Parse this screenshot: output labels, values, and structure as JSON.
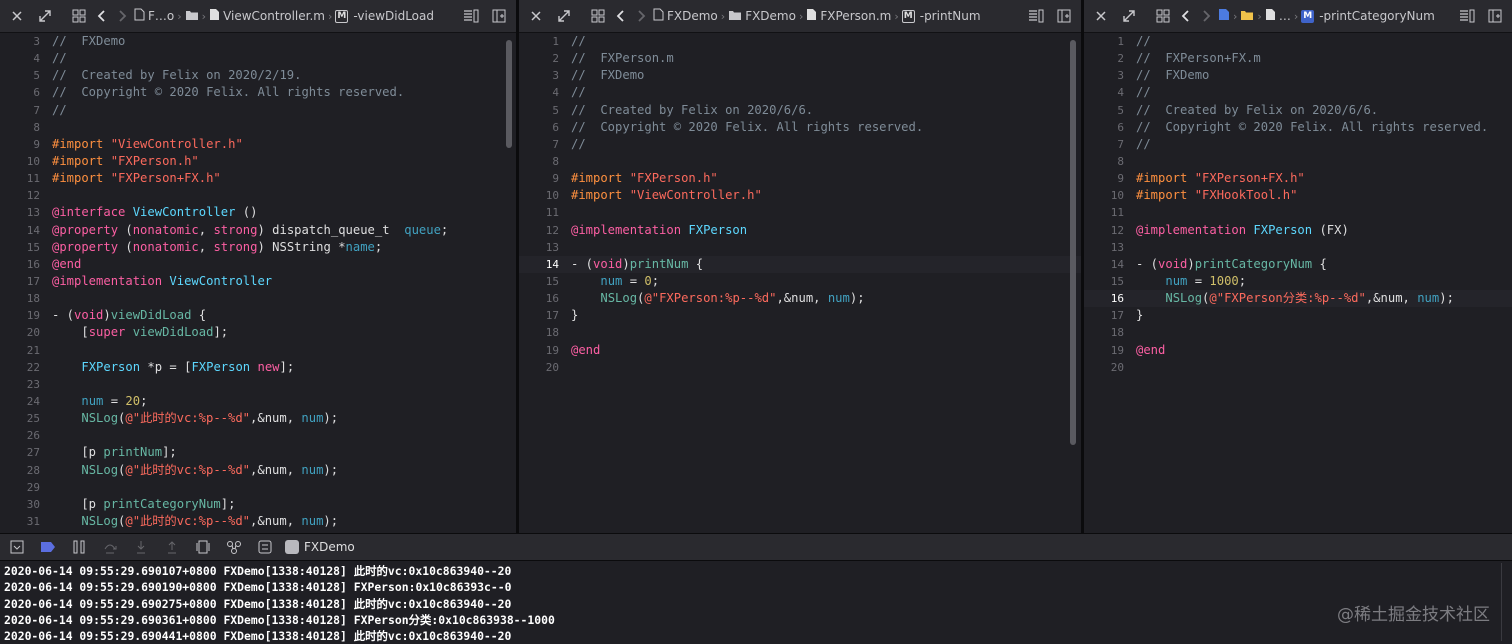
{
  "pane1": {
    "breadcrumbs": [
      "F…o",
      "",
      "ViewController.m",
      "-viewDidLoad"
    ],
    "lines": [
      {
        "n": "3",
        "t": [
          [
            "cmt",
            "//  FXDemo"
          ]
        ]
      },
      {
        "n": "4",
        "t": [
          [
            "cmt",
            "//"
          ]
        ]
      },
      {
        "n": "5",
        "t": [
          [
            "cmt",
            "//  Created by Felix on 2020/2/19."
          ]
        ]
      },
      {
        "n": "6",
        "t": [
          [
            "cmt",
            "//  Copyright © 2020 Felix. All rights reserved."
          ]
        ]
      },
      {
        "n": "7",
        "t": [
          [
            "cmt",
            "//"
          ]
        ]
      },
      {
        "n": "8",
        "t": []
      },
      {
        "n": "9",
        "t": [
          [
            "pre",
            "#import "
          ],
          [
            "str",
            "\"ViewController.h\""
          ]
        ]
      },
      {
        "n": "10",
        "t": [
          [
            "pre",
            "#import "
          ],
          [
            "str",
            "\"FXPerson.h\""
          ]
        ]
      },
      {
        "n": "11",
        "t": [
          [
            "pre",
            "#import "
          ],
          [
            "str",
            "\"FXPerson+FX.h\""
          ]
        ]
      },
      {
        "n": "12",
        "t": []
      },
      {
        "n": "13",
        "t": [
          [
            "kw",
            "@interface "
          ],
          [
            "tp",
            "ViewController"
          ],
          [
            "plain",
            " ()"
          ]
        ]
      },
      {
        "n": "14",
        "t": [
          [
            "kw",
            "@property "
          ],
          [
            "plain",
            "("
          ],
          [
            "kw",
            "nonatomic"
          ],
          [
            "plain",
            ", "
          ],
          [
            "kw",
            "strong"
          ],
          [
            "plain",
            ") dispatch_queue_t  "
          ],
          [
            "prop",
            "queue"
          ],
          [
            "plain",
            ";"
          ]
        ]
      },
      {
        "n": "15",
        "t": [
          [
            "kw",
            "@property "
          ],
          [
            "plain",
            "("
          ],
          [
            "kw",
            "nonatomic"
          ],
          [
            "plain",
            ", "
          ],
          [
            "kw",
            "strong"
          ],
          [
            "plain",
            ") NSString *"
          ],
          [
            "prop",
            "name"
          ],
          [
            "plain",
            ";"
          ]
        ]
      },
      {
        "n": "16",
        "t": [
          [
            "kw",
            "@end"
          ]
        ]
      },
      {
        "n": "17",
        "t": [
          [
            "kw",
            "@implementation "
          ],
          [
            "tp",
            "ViewController"
          ]
        ]
      },
      {
        "n": "18",
        "t": []
      },
      {
        "n": "19",
        "t": [
          [
            "plain",
            "- ("
          ],
          [
            "kw",
            "void"
          ],
          [
            "plain",
            ")"
          ],
          [
            "fn",
            "viewDidLoad"
          ],
          [
            "plain",
            " {"
          ]
        ]
      },
      {
        "n": "20",
        "t": [
          [
            "plain",
            "    ["
          ],
          [
            "kw",
            "super"
          ],
          [
            "plain",
            " "
          ],
          [
            "fn",
            "viewDidLoad"
          ],
          [
            "plain",
            "];"
          ]
        ]
      },
      {
        "n": "21",
        "t": []
      },
      {
        "n": "22",
        "t": [
          [
            "plain",
            "    "
          ],
          [
            "tp",
            "FXPerson"
          ],
          [
            "plain",
            " *p = ["
          ],
          [
            "tp",
            "FXPerson"
          ],
          [
            "plain",
            " "
          ],
          [
            "kw",
            "new"
          ],
          [
            "plain",
            "];"
          ]
        ]
      },
      {
        "n": "23",
        "t": []
      },
      {
        "n": "24",
        "t": [
          [
            "plain",
            "    "
          ],
          [
            "prop",
            "num"
          ],
          [
            "plain",
            " = "
          ],
          [
            "num",
            "20"
          ],
          [
            "plain",
            ";"
          ]
        ]
      },
      {
        "n": "25",
        "t": [
          [
            "plain",
            "    "
          ],
          [
            "fn",
            "NSLog"
          ],
          [
            "plain",
            "("
          ],
          [
            "str",
            "@\"此时的vc:%p--%d\""
          ],
          [
            "plain",
            ",&num, "
          ],
          [
            "prop",
            "num"
          ],
          [
            "plain",
            ");"
          ]
        ]
      },
      {
        "n": "26",
        "t": []
      },
      {
        "n": "27",
        "t": [
          [
            "plain",
            "    [p "
          ],
          [
            "fn",
            "printNum"
          ],
          [
            "plain",
            "];"
          ]
        ]
      },
      {
        "n": "28",
        "t": [
          [
            "plain",
            "    "
          ],
          [
            "fn",
            "NSLog"
          ],
          [
            "plain",
            "("
          ],
          [
            "str",
            "@\"此时的vc:%p--%d\""
          ],
          [
            "plain",
            ",&num, "
          ],
          [
            "prop",
            "num"
          ],
          [
            "plain",
            ");"
          ]
        ]
      },
      {
        "n": "29",
        "t": []
      },
      {
        "n": "30",
        "t": [
          [
            "plain",
            "    [p "
          ],
          [
            "fn",
            "printCategoryNum"
          ],
          [
            "plain",
            "];"
          ]
        ]
      },
      {
        "n": "31",
        "t": [
          [
            "plain",
            "    "
          ],
          [
            "fn",
            "NSLog"
          ],
          [
            "plain",
            "("
          ],
          [
            "str",
            "@\"此时的vc:%p--%d\""
          ],
          [
            "plain",
            ",&num, "
          ],
          [
            "prop",
            "num"
          ],
          [
            "plain",
            ");"
          ]
        ]
      }
    ]
  },
  "pane2": {
    "breadcrumbs": [
      "FXDemo",
      "FXDemo",
      "FXPerson.m",
      "-printNum"
    ],
    "current_line": "14",
    "lines": [
      {
        "n": "1",
        "t": [
          [
            "cmt",
            "//"
          ]
        ]
      },
      {
        "n": "2",
        "t": [
          [
            "cmt",
            "//  FXPerson.m"
          ]
        ]
      },
      {
        "n": "3",
        "t": [
          [
            "cmt",
            "//  FXDemo"
          ]
        ]
      },
      {
        "n": "4",
        "t": [
          [
            "cmt",
            "//"
          ]
        ]
      },
      {
        "n": "5",
        "t": [
          [
            "cmt",
            "//  Created by Felix on 2020/6/6."
          ]
        ]
      },
      {
        "n": "6",
        "t": [
          [
            "cmt",
            "//  Copyright © 2020 Felix. All rights reserved."
          ]
        ]
      },
      {
        "n": "7",
        "t": [
          [
            "cmt",
            "//"
          ]
        ]
      },
      {
        "n": "8",
        "t": []
      },
      {
        "n": "9",
        "t": [
          [
            "pre",
            "#import "
          ],
          [
            "str",
            "\"FXPerson.h\""
          ]
        ]
      },
      {
        "n": "10",
        "t": [
          [
            "pre",
            "#import "
          ],
          [
            "str",
            "\"ViewController.h\""
          ]
        ]
      },
      {
        "n": "11",
        "t": []
      },
      {
        "n": "12",
        "t": [
          [
            "kw",
            "@implementation "
          ],
          [
            "tp",
            "FXPerson"
          ]
        ]
      },
      {
        "n": "13",
        "t": []
      },
      {
        "n": "14",
        "t": [
          [
            "plain",
            "- ("
          ],
          [
            "kw",
            "void"
          ],
          [
            "plain",
            ")"
          ],
          [
            "fn",
            "printNum"
          ],
          [
            "plain",
            " {"
          ]
        ]
      },
      {
        "n": "15",
        "t": [
          [
            "plain",
            "    "
          ],
          [
            "prop",
            "num"
          ],
          [
            "plain",
            " = "
          ],
          [
            "num",
            "0"
          ],
          [
            "plain",
            ";"
          ]
        ]
      },
      {
        "n": "16",
        "t": [
          [
            "plain",
            "    "
          ],
          [
            "fn",
            "NSLog"
          ],
          [
            "plain",
            "("
          ],
          [
            "str",
            "@\"FXPerson:%p--%d\""
          ],
          [
            "plain",
            ",&num, "
          ],
          [
            "prop",
            "num"
          ],
          [
            "plain",
            ");"
          ]
        ]
      },
      {
        "n": "17",
        "t": [
          [
            "plain",
            "}"
          ]
        ]
      },
      {
        "n": "18",
        "t": []
      },
      {
        "n": "19",
        "t": [
          [
            "kw",
            "@end"
          ]
        ]
      },
      {
        "n": "20",
        "t": []
      }
    ]
  },
  "pane3": {
    "breadcrumbs": [
      "",
      "",
      "…",
      "-printCategoryNum"
    ],
    "current_line": "16",
    "lines": [
      {
        "n": "1",
        "t": [
          [
            "cmt",
            "//"
          ]
        ]
      },
      {
        "n": "2",
        "t": [
          [
            "cmt",
            "//  FXPerson+FX.m"
          ]
        ]
      },
      {
        "n": "3",
        "t": [
          [
            "cmt",
            "//  FXDemo"
          ]
        ]
      },
      {
        "n": "4",
        "t": [
          [
            "cmt",
            "//"
          ]
        ]
      },
      {
        "n": "5",
        "t": [
          [
            "cmt",
            "//  Created by Felix on 2020/6/6."
          ]
        ]
      },
      {
        "n": "6",
        "t": [
          [
            "cmt",
            "//  Copyright © 2020 Felix. All rights reserved."
          ]
        ]
      },
      {
        "n": "7",
        "t": [
          [
            "cmt",
            "//"
          ]
        ]
      },
      {
        "n": "8",
        "t": []
      },
      {
        "n": "9",
        "t": [
          [
            "pre",
            "#import "
          ],
          [
            "str",
            "\"FXPerson+FX.h\""
          ]
        ]
      },
      {
        "n": "10",
        "t": [
          [
            "pre",
            "#import "
          ],
          [
            "str",
            "\"FXHookTool.h\""
          ]
        ]
      },
      {
        "n": "11",
        "t": []
      },
      {
        "n": "12",
        "t": [
          [
            "kw",
            "@implementation "
          ],
          [
            "tp",
            "FXPerson"
          ],
          [
            "plain",
            " (FX)"
          ]
        ]
      },
      {
        "n": "13",
        "t": []
      },
      {
        "n": "14",
        "t": [
          [
            "plain",
            "- ("
          ],
          [
            "kw",
            "void"
          ],
          [
            "plain",
            ")"
          ],
          [
            "fn",
            "printCategoryNum"
          ],
          [
            "plain",
            " {"
          ]
        ]
      },
      {
        "n": "15",
        "t": [
          [
            "plain",
            "    "
          ],
          [
            "prop",
            "num"
          ],
          [
            "plain",
            " = "
          ],
          [
            "num",
            "1000"
          ],
          [
            "plain",
            ";"
          ]
        ]
      },
      {
        "n": "16",
        "t": [
          [
            "plain",
            "    "
          ],
          [
            "fn",
            "NSLog"
          ],
          [
            "plain",
            "("
          ],
          [
            "str",
            "@\"FXPerson分类:%p--%d\""
          ],
          [
            "plain",
            ",&num, "
          ],
          [
            "prop",
            "num"
          ],
          [
            "plain",
            ");"
          ]
        ]
      },
      {
        "n": "17",
        "t": [
          [
            "plain",
            "}"
          ]
        ]
      },
      {
        "n": "18",
        "t": []
      },
      {
        "n": "19",
        "t": [
          [
            "kw",
            "@end"
          ]
        ]
      },
      {
        "n": "20",
        "t": []
      }
    ]
  },
  "debug": {
    "scheme": "FXDemo"
  },
  "console": [
    "2020-06-14 09:55:29.690107+0800 FXDemo[1338:40128] 此时的vc:0x10c863940--20",
    "2020-06-14 09:55:29.690190+0800 FXDemo[1338:40128] FXPerson:0x10c86393c--0",
    "2020-06-14 09:55:29.690275+0800 FXDemo[1338:40128] 此时的vc:0x10c863940--20",
    "2020-06-14 09:55:29.690361+0800 FXDemo[1338:40128] FXPerson分类:0x10c863938--1000",
    "2020-06-14 09:55:29.690441+0800 FXDemo[1338:40128] 此时的vc:0x10c863940--20"
  ],
  "watermark": "@稀土掘金技术社区"
}
